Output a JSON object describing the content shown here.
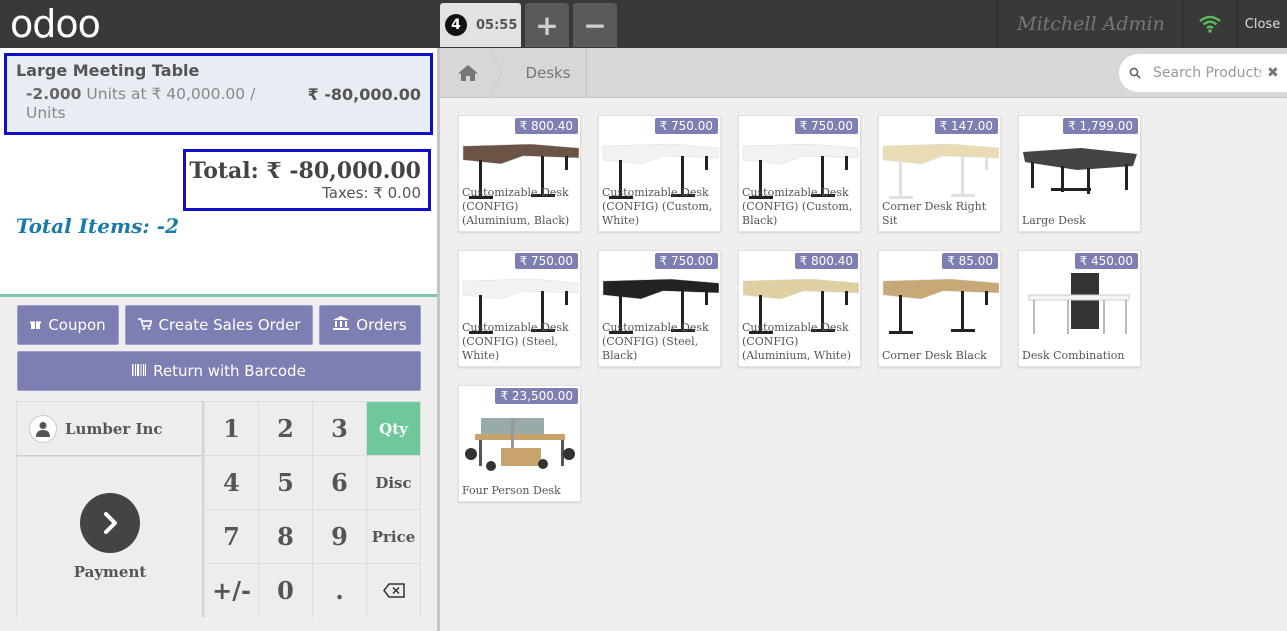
{
  "app": {
    "logo_text": "odoo",
    "user_name": "Mitchell Admin",
    "close_label": "Close"
  },
  "order_tab": {
    "number": "4",
    "time": "05:55"
  },
  "tab_buttons": {
    "add": "+",
    "remove": "−"
  },
  "order": {
    "line": {
      "product": "Large Meeting Table",
      "qty": "-2.000",
      "unit_detail": "Units at ₹ 40,000.00 / Units",
      "price": "₹ -80,000.00"
    },
    "total": "Total: ₹ -80,000.00",
    "taxes": "Taxes: ₹ 0.00",
    "total_items": "Total Items: -2"
  },
  "actions": {
    "coupon": "Coupon",
    "create_sales_order": "Create Sales Order",
    "orders": "Orders",
    "return_barcode": "Return with Barcode"
  },
  "customer": "Lumber Inc",
  "payment_label": "Payment",
  "numpad": {
    "keys": [
      "1",
      "2",
      "3",
      "4",
      "5",
      "6",
      "7",
      "8",
      "9",
      "+/-",
      "0",
      "."
    ],
    "modes": [
      "Qty",
      "Disc",
      "Price"
    ],
    "active_mode": "Qty",
    "backspace_icon": "backspace-icon"
  },
  "breadcrumb": {
    "category": "Desks"
  },
  "search": {
    "placeholder": "Search Products..."
  },
  "products": [
    {
      "name": "Customizable Desk (CONFIG) (Aluminium, Black)",
      "price": "₹ 800.40",
      "top_color": "#6b5446",
      "leg_color": "#222"
    },
    {
      "name": "Customizable Desk (CONFIG) (Custom, White)",
      "price": "₹ 750.00",
      "top_color": "#f2f2f2",
      "leg_color": "#222"
    },
    {
      "name": "Customizable Desk (CONFIG) (Custom, Black)",
      "price": "₹ 750.00",
      "top_color": "#f2f2f2",
      "leg_color": "#222"
    },
    {
      "name": "Corner Desk Right Sit",
      "price": "₹ 147.00",
      "top_color": "#e9dcb4",
      "leg_color": "#e0e0e0"
    },
    {
      "name": "Large Desk",
      "price": "₹ 1,799.00",
      "top_color": "#444444",
      "leg_color": "#222"
    },
    {
      "name": "Customizable Desk (CONFIG) (Steel, White)",
      "price": "₹ 750.00",
      "top_color": "#f2f2f2",
      "leg_color": "#222"
    },
    {
      "name": "Customizable Desk (CONFIG) (Steel, Black)",
      "price": "₹ 750.00",
      "top_color": "#222222",
      "leg_color": "#222"
    },
    {
      "name": "Customizable Desk (CONFIG) (Aluminium, White)",
      "price": "₹ 800.40",
      "top_color": "#dfd0a3",
      "leg_color": "#222"
    },
    {
      "name": "Corner Desk Black",
      "price": "₹ 85.00",
      "top_color": "#c9a877",
      "leg_color": "#222"
    },
    {
      "name": "Desk Combination",
      "price": "₹ 450.00",
      "top_color": "#f4f4f4",
      "leg_color": "#bbb"
    },
    {
      "name": "Four Person Desk",
      "price": "₹ 23,500.00",
      "top_color": "#c8a36c",
      "leg_color": "#555"
    }
  ],
  "colors": {
    "accent": "#7d7fb2",
    "active_key": "#6ec89b",
    "topbar": "#393939",
    "highlight_border": "#1010c8",
    "total_items": "#1a7aa8"
  }
}
